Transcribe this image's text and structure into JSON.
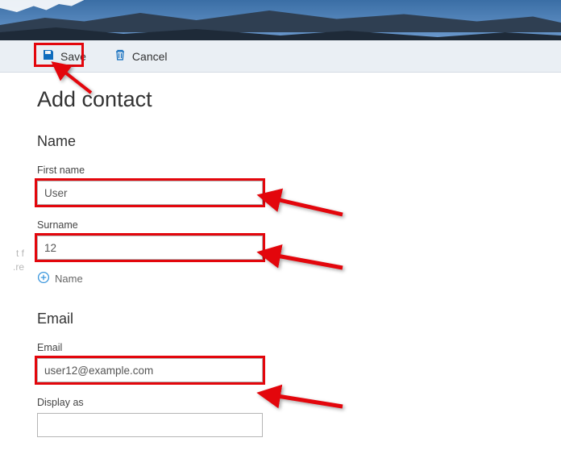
{
  "toolbar": {
    "save_label": "Save",
    "cancel_label": "Cancel"
  },
  "page": {
    "title": "Add contact"
  },
  "sections": {
    "name": {
      "heading": "Name",
      "first_label": "First name",
      "first_value": "User",
      "surname_label": "Surname",
      "surname_value": "12",
      "add_label": "Name"
    },
    "email": {
      "heading": "Email",
      "email_label": "Email",
      "email_value": "user12@example.com",
      "display_label": "Display as",
      "display_value": ""
    }
  },
  "edge": {
    "line1": "t f",
    "line2": "re."
  }
}
